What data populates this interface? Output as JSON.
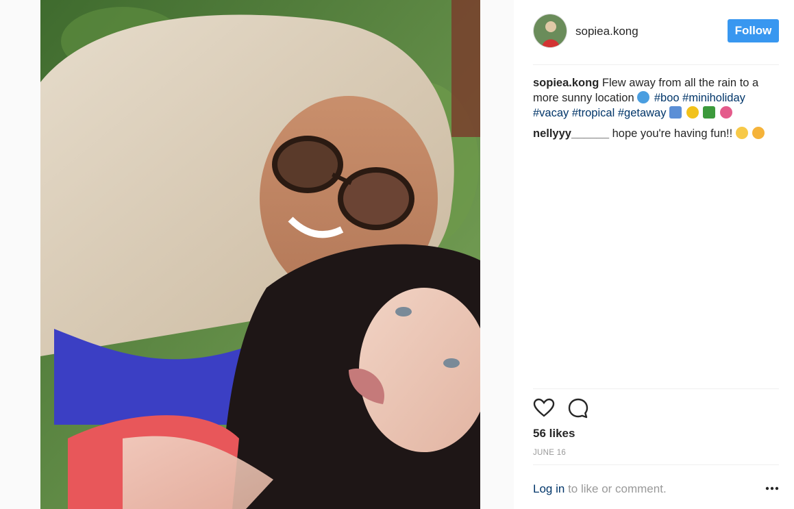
{
  "post": {
    "username": "sopiea.kong",
    "follow_label": "Follow",
    "caption": {
      "user": "sopiea.kong",
      "text_before": "Flew away from all the rain to a more sunny location",
      "tags_line1": [
        "#boo",
        "#miniholiday"
      ],
      "tags_line2": [
        "#vacay",
        "#tropical",
        "#getaway"
      ]
    },
    "comments": [
      {
        "user": "nellyyy______",
        "text": "hope you're having fun!!"
      }
    ],
    "likes": "56 likes",
    "date": "JUNE 16",
    "login": {
      "link": "Log in",
      "text": "to like or comment."
    }
  },
  "icons": {
    "like": "heart-icon",
    "comment": "comment-icon",
    "more": "more-options-icon"
  },
  "colors": {
    "follow_button": "#3897f0",
    "link": "#003569",
    "muted": "#999999"
  }
}
